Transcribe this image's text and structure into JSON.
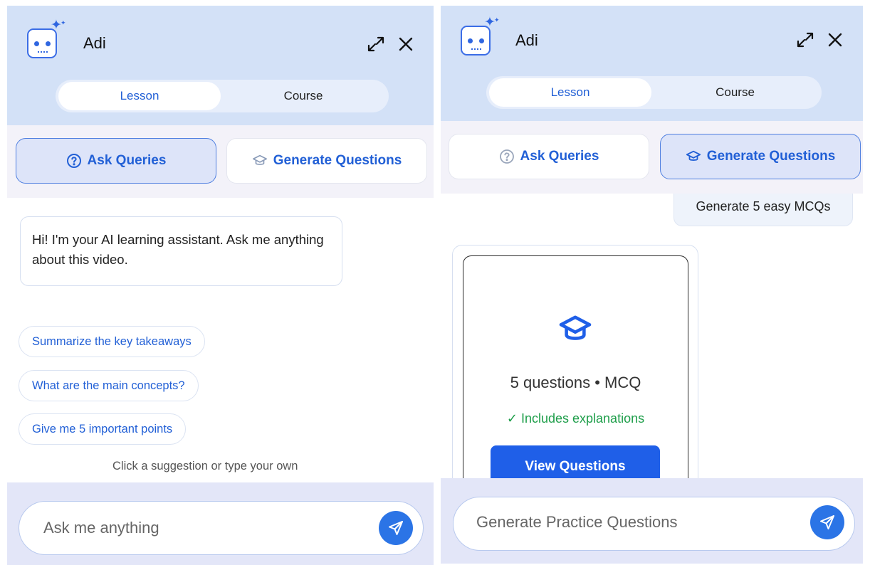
{
  "left": {
    "header": {
      "title": "Adi"
    },
    "tabs": {
      "lesson": "Lesson",
      "course": "Course"
    },
    "actions": {
      "ask": "Ask Queries",
      "generate": "Generate Questions"
    },
    "chat": {
      "greeting": "Hi! I'm your AI learning assistant. Ask me anything about this video.",
      "suggestions": [
        "Summarize the key takeaways",
        "What are the main concepts?",
        "Give me 5 important points"
      ],
      "hint": "Click a suggestion or type your own"
    },
    "input": {
      "placeholder": "Ask me anything"
    }
  },
  "right": {
    "header": {
      "title": "Adi"
    },
    "tabs": {
      "lesson": "Lesson",
      "course": "Course"
    },
    "actions": {
      "ask": "Ask Queries",
      "generate": "Generate Questions"
    },
    "chat": {
      "user_message": "Generate 5 easy MCQs",
      "card": {
        "count_label": "5 questions • MCQ",
        "explanations_label": "✓ Includes explanations",
        "view_button": "View Questions"
      }
    },
    "input": {
      "placeholder": "Generate Practice Questions"
    }
  },
  "icons": {
    "avatar": "robot-face-icon",
    "expand": "expand-arrows-icon",
    "close": "close-icon",
    "ask": "question-circle-icon",
    "generate": "graduation-cap-icon",
    "send": "paper-plane-icon"
  },
  "colors": {
    "accent": "#2260d6",
    "header_bg": "#d3e1f7",
    "send_button": "#2b74e6",
    "view_button": "#1f5fe8",
    "success": "#1e9e4a"
  }
}
